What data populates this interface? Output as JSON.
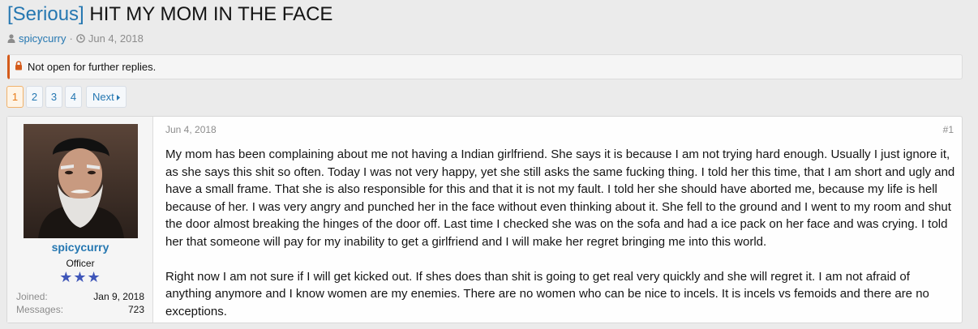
{
  "thread": {
    "prefix": "[Serious]",
    "title": "HIT MY MOM IN THE FACE",
    "author": "spicycurry",
    "separator": "·",
    "date": "Jun 4, 2018"
  },
  "notice": {
    "text": "Not open for further replies."
  },
  "pagination": {
    "pages": [
      "1",
      "2",
      "3",
      "4"
    ],
    "current": "1",
    "next_label": "Next"
  },
  "post": {
    "date": "Jun 4, 2018",
    "number": "#1",
    "paragraphs": [
      "My mom has been complaining about me not having a Indian girlfriend. She says it is because I am not trying hard enough. Usually I just ignore it, as she says this shit so often. Today I was not very happy, yet she still asks the same fucking thing. I told her this time, that I am short and ugly and have a small frame. That she is also responsible for this and that it is not my fault. I told her she should have aborted me, because my life is hell because of her. I was very angry and punched her in the face without even thinking about it. She fell to the ground and I went to my room and shut the door almost breaking the hinges of the door off. Last time I checked she was on the sofa and had a ice pack on her face and was crying. I told her that someone will pay for my inability to get a girlfriend and I will make her regret bringing me into this world.",
      "Right now I am not sure if I will get kicked out. If shes does than shit is going to get real very quickly and she will regret it. I am not afraid of anything anymore and I know women are my enemies. There are no women who can be nice to incels. It is incels vs femoids and there are no exceptions."
    ]
  },
  "user": {
    "name": "spicycurry",
    "rank": "Officer",
    "stars": "★★★",
    "stats": [
      {
        "label": "Joined:",
        "value": "Jan 9, 2018"
      },
      {
        "label": "Messages:",
        "value": "723"
      }
    ]
  },
  "colors": {
    "link": "#2577b1",
    "accent": "#e87b16",
    "notice_border": "#d45a1a",
    "stars": "#3f56b9"
  },
  "icons": [
    "user-icon",
    "clock-icon",
    "lock-icon",
    "caret-right-icon"
  ]
}
